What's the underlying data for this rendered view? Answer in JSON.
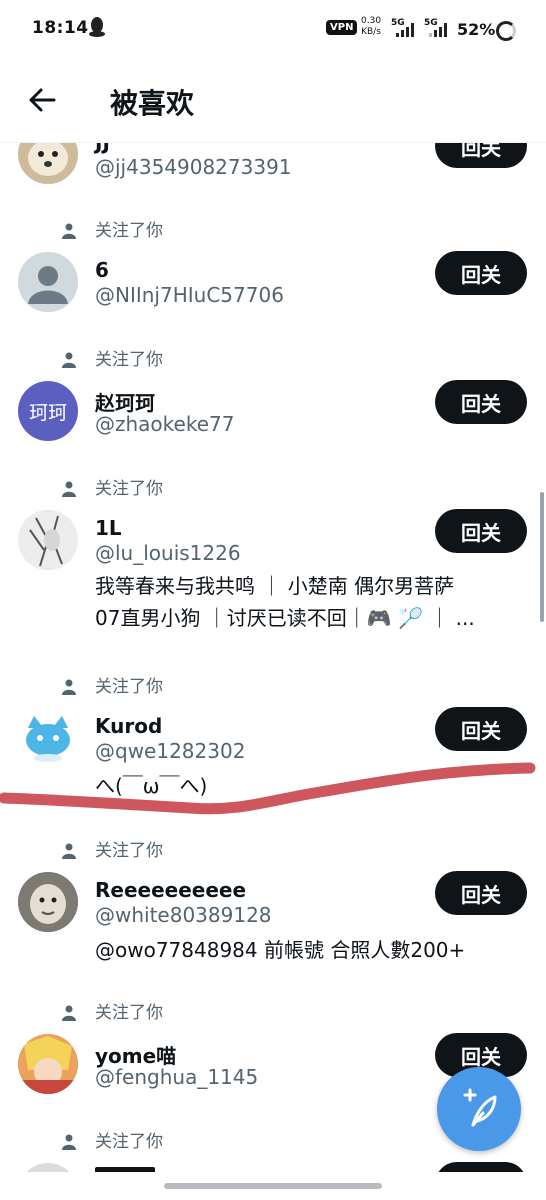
{
  "status_bar": {
    "time": "18:14",
    "vpn": "VPN",
    "speed_value": "0.30",
    "speed_unit": "KB/s",
    "net1": "5G",
    "net2": "5G",
    "battery": "52%"
  },
  "header": {
    "title": "被喜欢"
  },
  "follow_label": "回关",
  "note": "关注了你",
  "users": [
    {
      "name": "JJ",
      "handle": "@jj4354908273391"
    },
    {
      "name": "6",
      "handle": "@NIInj7HIuC57706"
    },
    {
      "name": "赵珂珂",
      "handle": "@zhaokeke77",
      "avatar_text": "珂珂"
    },
    {
      "name": "1L",
      "handle": "@lu_louis1226",
      "bio_line1": "我等春来与我共鸣 ｜ 小楚南 偶尔男菩萨",
      "bio_line2": "07直男小狗 ｜讨厌已读不回｜🎮 🏸 ｜ ..."
    },
    {
      "name": "Kurod",
      "handle": "@qwe1282302",
      "bio": "へ(￣ω￣へ)"
    },
    {
      "name": "Reeeeeeeeee",
      "handle": "@white80389128",
      "bio": "@owo77848984 前帳號 合照人數200+"
    },
    {
      "name": "yome喵",
      "handle": "@fenghua_1145"
    }
  ],
  "colors": {
    "button": "#0f1419",
    "secondary_text": "#536471",
    "fab": "#4a99e9",
    "strike": "#c9494f"
  }
}
